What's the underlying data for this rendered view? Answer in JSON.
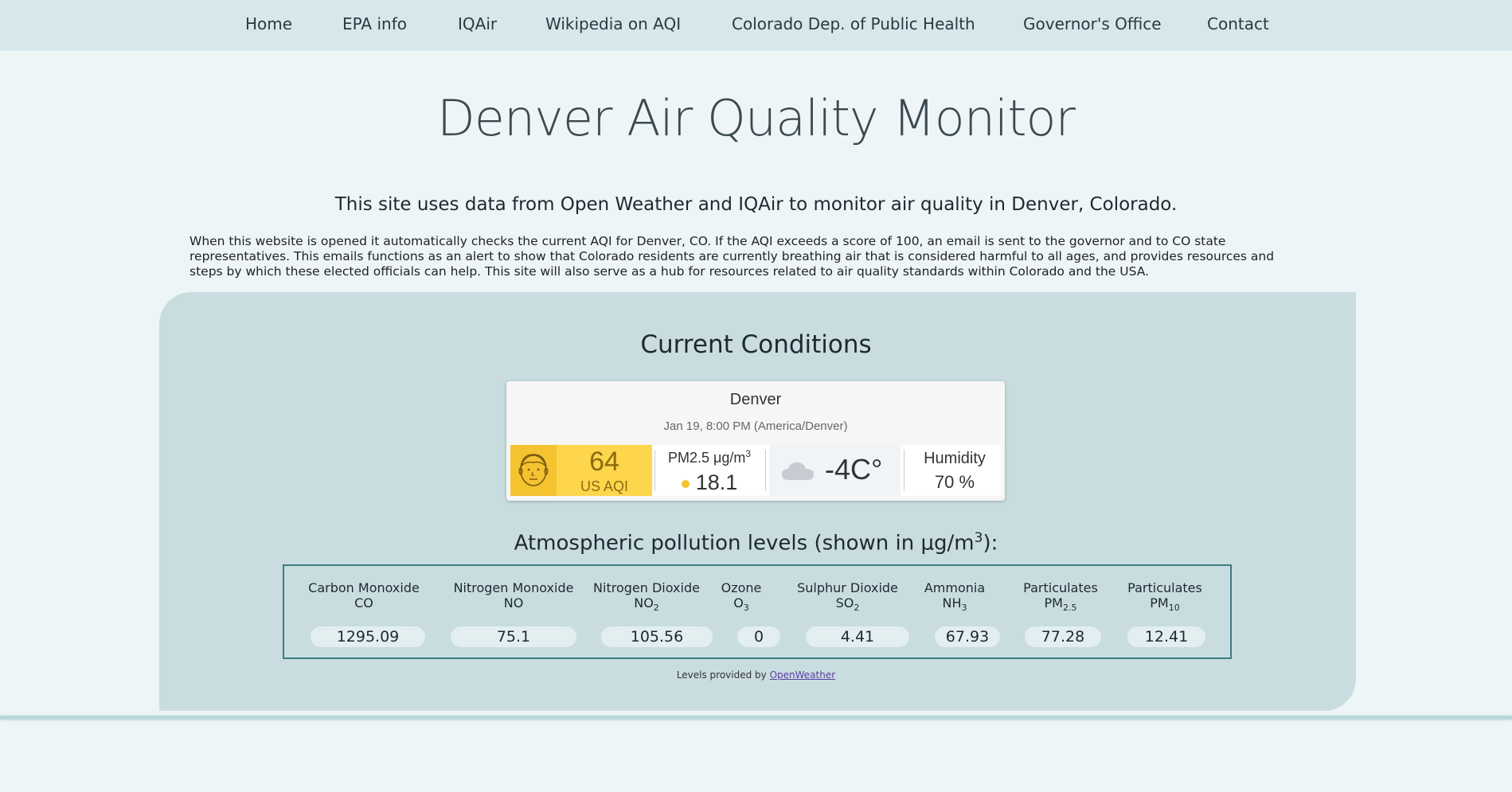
{
  "nav": {
    "items": [
      {
        "label": "Home"
      },
      {
        "label": "EPA info"
      },
      {
        "label": "IQAir"
      },
      {
        "label": "Wikipedia on AQI"
      },
      {
        "label": "Colorado Dep. of Public Health"
      },
      {
        "label": "Governor's Office"
      },
      {
        "label": "Contact"
      }
    ]
  },
  "page": {
    "title": "Denver Air Quality Monitor",
    "subtitle": "This site uses data from Open Weather and IQAir to monitor air quality in Denver, Colorado.",
    "intro": "When this website is opened it automatically checks the current AQI for Denver, CO. If the AQI exceeds a score of 100, an email is sent to the governor and to CO state representatives. This emails functions as an alert to show that Colorado residents are currently breathing air that is considered harmful to all ages, and provides resources and steps by which these elected officials can help. This site will also serve as a hub for resources related to air quality standards within Colorado and the USA."
  },
  "conditions": {
    "heading": "Current Conditions",
    "widget": {
      "city": "Denver",
      "time": "Jan 19, 8:00 PM (America/Denver)",
      "aqi_value": "64",
      "aqi_label": "US AQI",
      "pm_label": "PM2.5 μg/m",
      "pm_label_sup": "3",
      "pm_value": "18.1",
      "temperature": "-4C°",
      "humidity_label": "Humidity",
      "humidity_value": "70 %",
      "face_icon": "face-icon",
      "weather_icon": "cloud-icon",
      "aqi_color": "#fdd64b"
    }
  },
  "pollution": {
    "heading_pre": "Atmospheric pollution levels (shown in μg/m",
    "heading_sup": "3",
    "heading_post": "):",
    "items": [
      {
        "name": "Carbon Monoxide",
        "formula": "CO",
        "formula_sub": "",
        "value": "1295.09"
      },
      {
        "name": "Nitrogen Monoxide",
        "formula": "NO",
        "formula_sub": "",
        "value": "75.1"
      },
      {
        "name": "Nitrogen Dioxide",
        "formula": "NO",
        "formula_sub": "2",
        "value": "105.56"
      },
      {
        "name": "Ozone",
        "formula": "O",
        "formula_sub": "3",
        "value": "0"
      },
      {
        "name": "Sulphur Dioxide",
        "formula": "SO",
        "formula_sub": "2",
        "value": "4.41"
      },
      {
        "name": "Ammonia",
        "formula": "NH",
        "formula_sub": "3",
        "value": "67.93"
      },
      {
        "name": "Particulates",
        "formula": "PM",
        "formula_sub": "2.5",
        "value": "77.28"
      },
      {
        "name": "Particulates",
        "formula": "PM",
        "formula_sub": "10",
        "value": "12.41"
      }
    ],
    "credit_prefix": "Levels provided by ",
    "credit_link": "OpenWeather"
  }
}
